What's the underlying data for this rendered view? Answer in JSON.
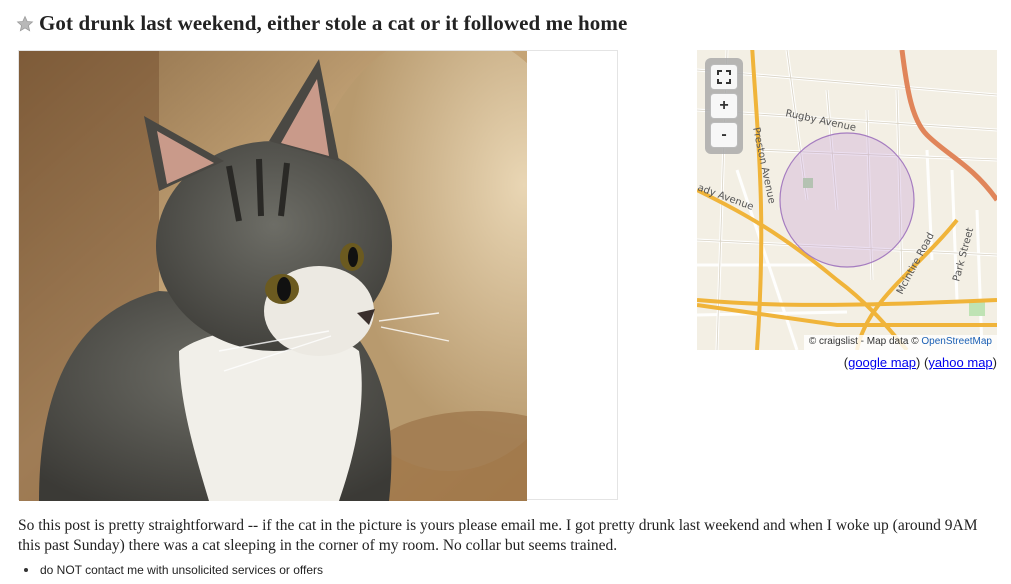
{
  "posting": {
    "title": "Got drunk last weekend, either stole a cat or it followed me home",
    "body": "So this post is pretty straightforward -- if the cat in the picture is yours please email me. I got pretty drunk last weekend and when I woke up (around 9AM this past Sunday) there was a cat sleeping in the corner of my room. No collar but seems trained."
  },
  "image": {
    "description_icon": "cat-photo"
  },
  "map": {
    "fullscreen_icon": "fullscreen-icon",
    "zoom_in_label": "+",
    "zoom_out_label": "-",
    "streets": [
      "Rugby Avenue",
      "Preston Avenue",
      "ady Avenue",
      "Mcintire Road",
      "Park Street"
    ],
    "attribution_prefix": "© craigslist - Map data ©",
    "attribution_link": "OpenStreetMap",
    "links": {
      "open_paren_1": "(",
      "google_label": "google map",
      "mid": ") (",
      "yahoo_label": "yahoo map",
      "close_paren": ")"
    }
  },
  "notices": [
    "do NOT contact me with unsolicited services or offers"
  ],
  "colors": {
    "link": "#0000ee",
    "major_road": "#f0b43a",
    "highway": "#e0855a",
    "radius_fill": "#c9a4d8"
  }
}
